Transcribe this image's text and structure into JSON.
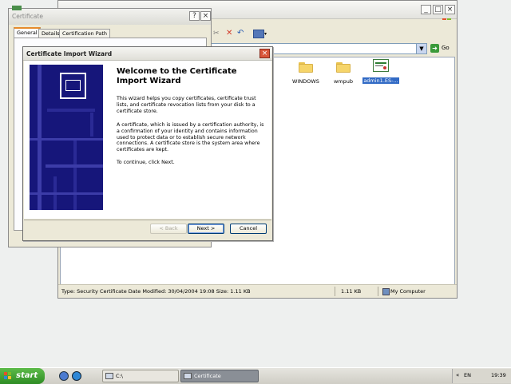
{
  "explorer": {
    "go_label": "Go",
    "files": [
      {
        "name": "WINDOWS",
        "type": "folder"
      },
      {
        "name": "wmpub",
        "type": "folder"
      },
      {
        "name": "admin1.ES-...",
        "type": "certificate",
        "selected": true
      }
    ],
    "status": {
      "details": "Type: Security Certificate Date Modified: 30/04/2004 19:08 Size: 1.11 KB",
      "size": "1.11 KB",
      "location": "My Computer"
    }
  },
  "cert_dialog": {
    "title": "Certificate",
    "tabs": [
      "General",
      "Details",
      "Certification Path"
    ]
  },
  "wizard": {
    "title": "Certificate Import Wizard",
    "heading": "Welcome to the Certificate Import Wizard",
    "para1": "This wizard helps you copy certificates, certificate trust lists, and certificate revocation lists from your disk to a certificate store.",
    "para2": "A certificate, which is issued by a certification authority, is a confirmation of your identity and contains information used to protect data or to establish secure network connections. A certificate store is the system area where certificates are kept.",
    "para3": "To continue, click Next.",
    "buttons": {
      "back": "< Back",
      "next": "Next >",
      "cancel": "Cancel"
    }
  },
  "taskbar": {
    "start_label": "start",
    "tasks": [
      {
        "label": "C:\\",
        "active": false
      },
      {
        "label": "Certificate",
        "active": true
      }
    ],
    "language": "EN",
    "clock": "19:39"
  },
  "colors": {
    "wizard_art": "#16167a",
    "start_green": "#2e8c24",
    "selection": "#316ac5"
  }
}
